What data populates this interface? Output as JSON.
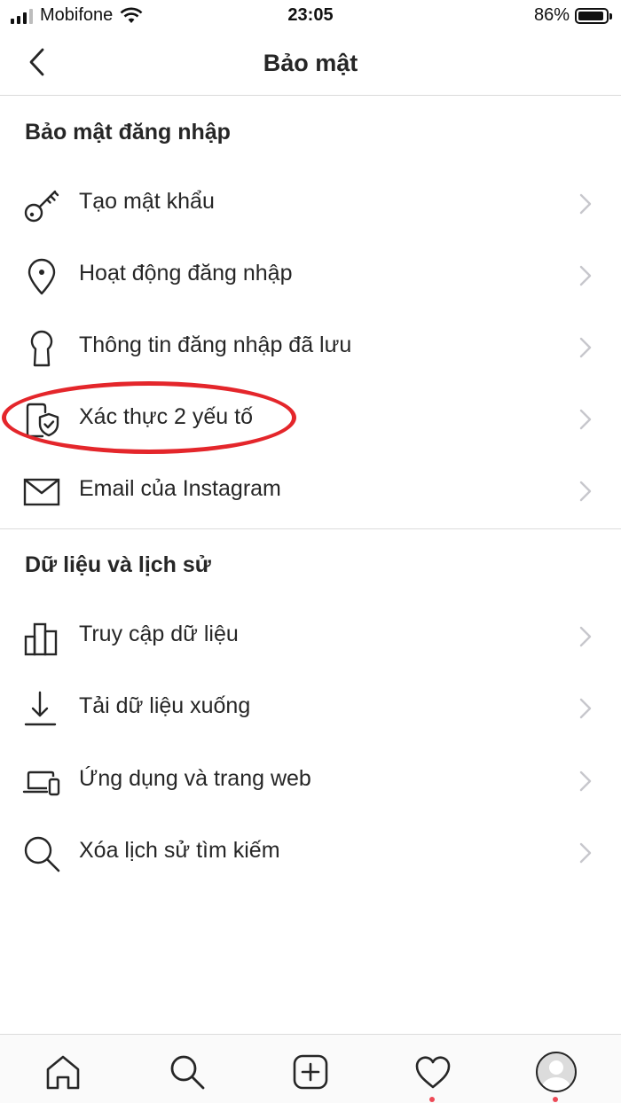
{
  "status_bar": {
    "carrier": "Mobifone",
    "time": "23:05",
    "battery": "86%",
    "battery_level": 0.86,
    "signal_bars_filled": 3,
    "signal_bars_total": 4
  },
  "header": {
    "title": "Bảo mật",
    "back_icon": "chevron-left-icon"
  },
  "sections": [
    {
      "title": "Bảo mật đăng nhập",
      "items": [
        {
          "label": "Tạo mật khẩu",
          "icon": "key-icon"
        },
        {
          "label": "Hoạt động đăng nhập",
          "icon": "location-pin-icon"
        },
        {
          "label": "Thông tin đăng nhập đã lưu",
          "icon": "keyhole-icon"
        },
        {
          "label": "Xác thực 2 yếu tố",
          "icon": "shield-phone-icon",
          "highlighted": true
        },
        {
          "label": "Email của Instagram",
          "icon": "envelope-icon"
        }
      ]
    },
    {
      "title": "Dữ liệu và lịch sử",
      "items": [
        {
          "label": "Truy cập dữ liệu",
          "icon": "bar-chart-icon"
        },
        {
          "label": "Tải dữ liệu xuống",
          "icon": "download-icon"
        },
        {
          "label": "Ứng dụng và trang web",
          "icon": "laptop-phone-icon"
        },
        {
          "label": "Xóa lịch sử tìm kiếm",
          "icon": "search-icon"
        }
      ]
    }
  ],
  "tab_bar": {
    "tabs": [
      {
        "icon": "home-icon"
      },
      {
        "icon": "search-icon"
      },
      {
        "icon": "new-post-icon"
      },
      {
        "icon": "heart-icon",
        "notification_dot": true
      },
      {
        "icon": "profile-avatar-icon",
        "notification_dot": true
      }
    ]
  },
  "colors": {
    "text": "#262626",
    "divider": "#dbdbdb",
    "chevron": "#c7c7cc",
    "highlight_ring": "#e4262b",
    "notification_dot": "#ed4956"
  }
}
